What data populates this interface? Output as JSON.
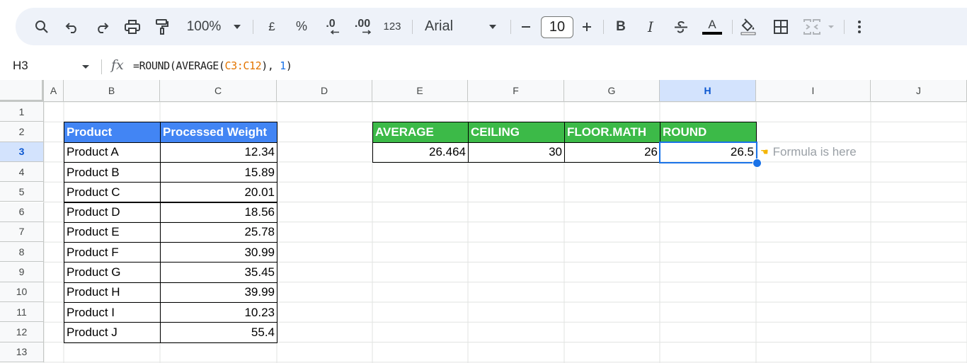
{
  "toolbar": {
    "zoom": "100%",
    "currency": "£",
    "percent": "%",
    "decrease_decimal": ".0",
    "increase_decimal": ".00",
    "format_number": "123",
    "font": "Arial",
    "font_size": "10",
    "bold": "B",
    "italic": "I",
    "text_color": "A"
  },
  "formula_bar": {
    "name_box": "H3",
    "fx": "fx",
    "formula_prefix": "=ROUND(AVERAGE(",
    "formula_range": "C3:C12",
    "formula_mid": "), ",
    "formula_digits": "1",
    "formula_suffix": ")"
  },
  "grid": {
    "columns": [
      "A",
      "B",
      "C",
      "D",
      "E",
      "F",
      "G",
      "H",
      "I",
      "J"
    ],
    "rows": [
      "1",
      "2",
      "3",
      "4",
      "5",
      "6",
      "7",
      "8",
      "9",
      "10",
      "11",
      "12",
      "13"
    ],
    "active_column": "H",
    "active_row": "3"
  },
  "product_table": {
    "headers": [
      "Product",
      "Processed Weight"
    ],
    "rows": [
      [
        "Product A",
        "12.34"
      ],
      [
        "Product B",
        "15.89"
      ],
      [
        "Product C",
        "20.01"
      ],
      [
        "Product D",
        "18.56"
      ],
      [
        "Product E",
        "25.78"
      ],
      [
        "Product F",
        "30.99"
      ],
      [
        "Product G",
        "35.45"
      ],
      [
        "Product H",
        "39.99"
      ],
      [
        "Product I",
        "10.23"
      ],
      [
        "Product J",
        "55.4"
      ]
    ]
  },
  "results_table": {
    "headers": [
      "AVERAGE",
      "CEILING",
      "FLOOR.MATH",
      "ROUND"
    ],
    "values": [
      "26.464",
      "30",
      "26",
      "26.5"
    ]
  },
  "annotation": {
    "icon": "pointing-hand-icon",
    "text": "Formula is here"
  },
  "colors": {
    "blue_header": "#4285f4",
    "green_header": "#3cba48",
    "selection": "#1a73e8"
  }
}
